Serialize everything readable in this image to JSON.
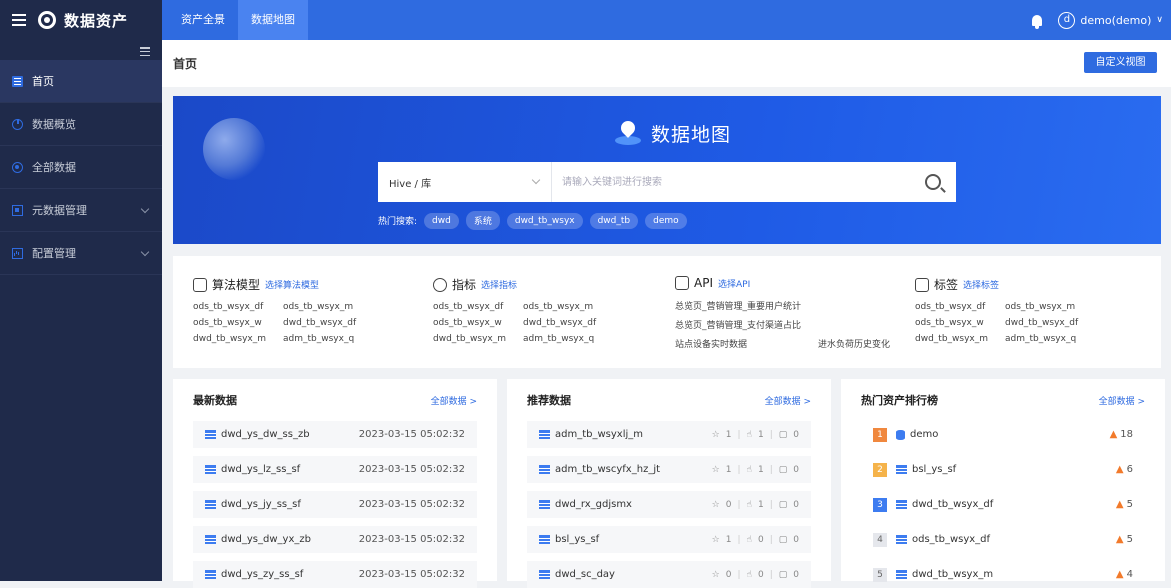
{
  "topbar": {
    "brand": "数据资产",
    "tabs": [
      "资产全景",
      "数据地图"
    ],
    "active_tab": 1,
    "avatar_letter": "d",
    "user": "demo(demo)",
    "accent": "#2f6be0"
  },
  "sidebar": {
    "items": [
      {
        "label": "首页",
        "icon": "home-icon"
      },
      {
        "label": "数据概览",
        "icon": "pie-chart-icon"
      },
      {
        "label": "全部数据",
        "icon": "target-icon"
      },
      {
        "label": "元数据管理",
        "icon": "metadata-icon"
      },
      {
        "label": "配置管理",
        "icon": "config-icon"
      }
    ]
  },
  "page": {
    "title": "首页",
    "custom_view_button": "自定义视图"
  },
  "hero": {
    "title": "数据地图",
    "select_value": "Hive / 库",
    "search_placeholder": "请输入关键词进行搜索",
    "hot_label": "热门搜索:",
    "hot_tags": [
      "dwd",
      "系统",
      "dwd_tb_wsyx",
      "dwd_tb",
      "demo"
    ]
  },
  "categories": [
    {
      "title": "算法模型",
      "link": "选择算法模型",
      "items": [
        "ods_tb_wsyx_df",
        "ods_tb_wsyx_m",
        "ods_tb_wsyx_w",
        "dwd_tb_wsyx_df",
        "dwd_tb_wsyx_m",
        "adm_tb_wsyx_q"
      ]
    },
    {
      "title": "指标",
      "link": "选择指标",
      "items": [
        "ods_tb_wsyx_df",
        "ods_tb_wsyx_m",
        "ods_tb_wsyx_w",
        "dwd_tb_wsyx_df",
        "dwd_tb_wsyx_m",
        "adm_tb_wsyx_q"
      ]
    },
    {
      "title": "API",
      "link": "选择API",
      "items": [
        "总览页_营销管理_重要用户统计",
        "",
        "总览页_营销管理_支付渠道占比",
        "",
        "站点设备实时数据",
        "进水负荷历史变化"
      ]
    },
    {
      "title": "标签",
      "link": "选择标签",
      "items": [
        "ods_tb_wsyx_df",
        "ods_tb_wsyx_m",
        "ods_tb_wsyx_w",
        "dwd_tb_wsyx_df",
        "dwd_tb_wsyx_m",
        "adm_tb_wsyx_q"
      ]
    }
  ],
  "latest": {
    "title": "最新数据",
    "more": "全部数据 >",
    "rows": [
      {
        "name": "dwd_ys_dw_ss_zb",
        "time": "2023-03-15 05:02:32"
      },
      {
        "name": "dwd_ys_lz_ss_sf",
        "time": "2023-03-15 05:02:32"
      },
      {
        "name": "dwd_ys_jy_ss_sf",
        "time": "2023-03-15 05:02:32"
      },
      {
        "name": "dwd_ys_dw_yx_zb",
        "time": "2023-03-15 05:02:32"
      },
      {
        "name": "dwd_ys_zy_ss_sf",
        "time": "2023-03-15 05:02:32"
      }
    ]
  },
  "recommended": {
    "title": "推荐数据",
    "more": "全部数据 >",
    "rows": [
      {
        "name": "adm_tb_wsyxlj_m",
        "stars": "1",
        "likes": "1",
        "comments": "0"
      },
      {
        "name": "adm_tb_wscyfx_hz_jt",
        "stars": "1",
        "likes": "1",
        "comments": "0"
      },
      {
        "name": "dwd_rx_gdjsmx",
        "stars": "0",
        "likes": "1",
        "comments": "0"
      },
      {
        "name": "bsl_ys_sf",
        "stars": "1",
        "likes": "0",
        "comments": "0"
      },
      {
        "name": "dwd_sc_day",
        "stars": "0",
        "likes": "0",
        "comments": "0"
      }
    ]
  },
  "hot": {
    "title": "热门资产排行榜",
    "more": "全部数据 >",
    "rows": [
      {
        "rank": "1",
        "name": "demo",
        "icon": "database-icon",
        "hits": "18"
      },
      {
        "rank": "2",
        "name": "bsl_ys_sf",
        "icon": "table-icon",
        "hits": "6"
      },
      {
        "rank": "3",
        "name": "dwd_tb_wsyx_df",
        "icon": "table-icon",
        "hits": "5"
      },
      {
        "rank": "4",
        "name": "ods_tb_wsyx_df",
        "icon": "table-icon",
        "hits": "5"
      },
      {
        "rank": "5",
        "name": "dwd_tb_wsyx_m",
        "icon": "table-icon",
        "hits": "4"
      }
    ]
  }
}
